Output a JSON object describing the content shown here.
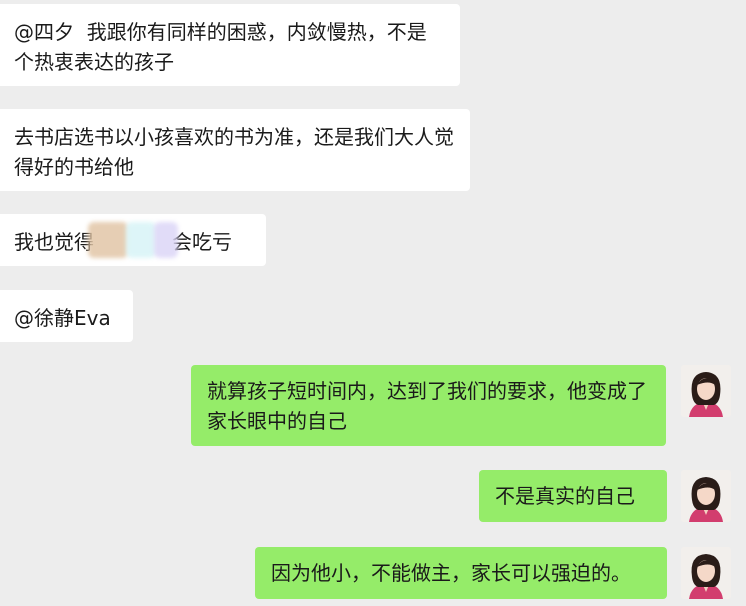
{
  "messages_in": [
    {
      "text": "@四夕  我跟你有同样的困惑，内敛慢热，不是个热衷表达的孩子"
    },
    {
      "text": "去书店选书以小孩喜欢的书为准，还是我们大人觉得好的书给他"
    },
    {
      "text_before": "我也觉得",
      "text_after": "会吃亏"
    },
    {
      "text": "@徐静Eva"
    }
  ],
  "messages_out": [
    {
      "text": "就算孩子短时间内，达到了我们的要求，他变成了家长眼中的自己"
    },
    {
      "text": "不是真实的自己"
    },
    {
      "text": "因为他小，不能做主，家长可以强迫的。"
    }
  ],
  "colors": {
    "background": "#ededed",
    "incoming_bubble": "#ffffff",
    "outgoing_bubble": "#95ec69"
  }
}
